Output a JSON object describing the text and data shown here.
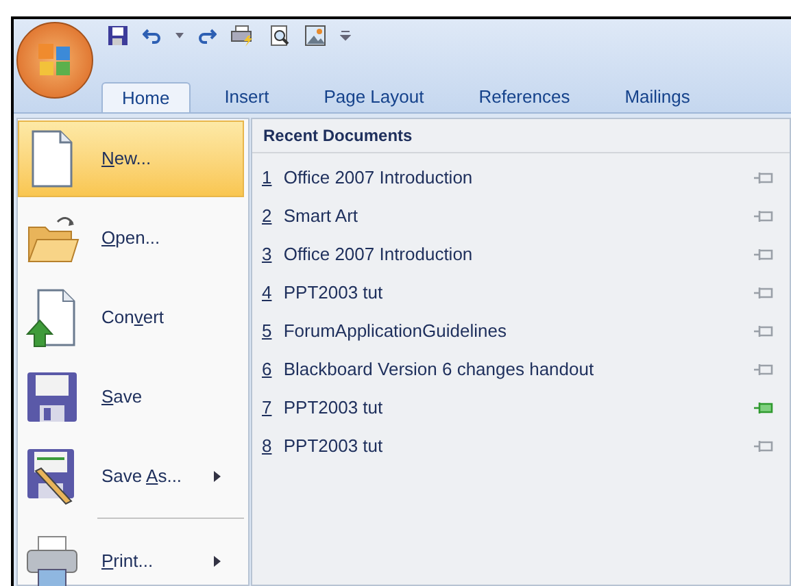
{
  "tabs": [
    {
      "label": "Home",
      "selected": true
    },
    {
      "label": "Insert",
      "selected": false
    },
    {
      "label": "Page Layout",
      "selected": false
    },
    {
      "label": "References",
      "selected": false
    },
    {
      "label": "Mailings",
      "selected": false
    }
  ],
  "menu": [
    {
      "kind": "new",
      "key": "N",
      "after": "ew...",
      "selected": true,
      "submenu": false
    },
    {
      "kind": "open",
      "key": "O",
      "after": "pen...",
      "selected": false,
      "submenu": false
    },
    {
      "kind": "convert",
      "before": "Con",
      "key": "v",
      "after": "ert",
      "selected": false,
      "submenu": false
    },
    {
      "kind": "save",
      "key": "S",
      "after": "ave",
      "selected": false,
      "submenu": false
    },
    {
      "kind": "saveas",
      "before": "Save ",
      "key": "A",
      "after": "s...",
      "selected": false,
      "submenu": true
    },
    {
      "kind": "print",
      "key": "P",
      "after": "rint...",
      "selected": false,
      "submenu": true
    }
  ],
  "recent": {
    "title": "Recent Documents",
    "items": [
      {
        "number": "1",
        "name": "Office 2007 Introduction",
        "pinned": false
      },
      {
        "number": "2",
        "name": "Smart Art",
        "pinned": false
      },
      {
        "number": "3",
        "name": "Office 2007 Introduction",
        "pinned": false
      },
      {
        "number": "4",
        "name": "PPT2003 tut",
        "pinned": false
      },
      {
        "number": "5",
        "name": "ForumApplicationGuidelines",
        "pinned": false
      },
      {
        "number": "6",
        "name": "Blackboard Version 6 changes handout",
        "pinned": false
      },
      {
        "number": "7",
        "name": "PPT2003 tut",
        "pinned": true
      },
      {
        "number": "8",
        "name": "PPT2003 tut",
        "pinned": false
      }
    ]
  }
}
